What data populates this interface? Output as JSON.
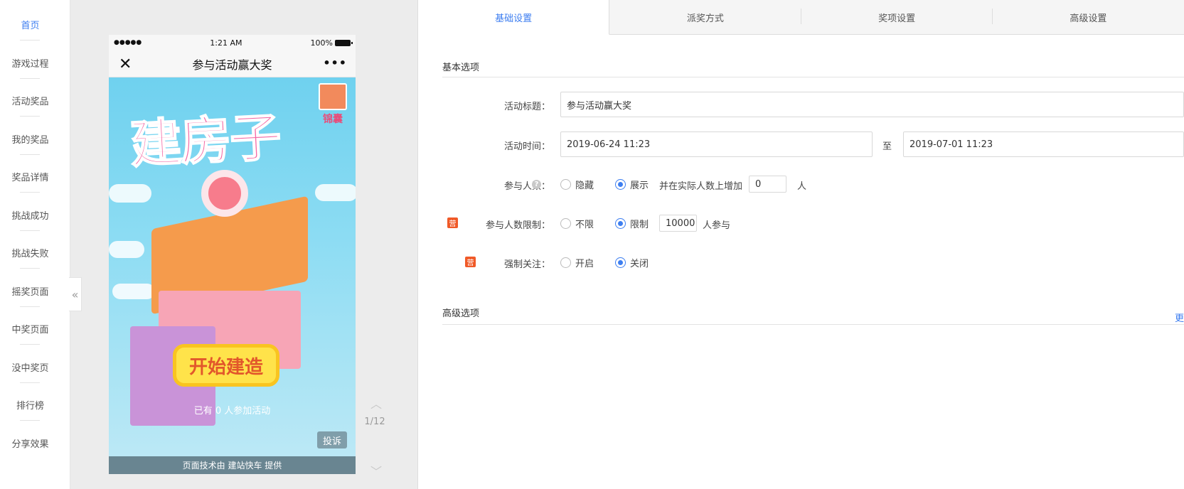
{
  "nav": {
    "items": [
      {
        "label": "首页",
        "active": true
      },
      {
        "label": "游戏过程"
      },
      {
        "label": "活动奖品"
      },
      {
        "label": "我的奖品"
      },
      {
        "label": "奖品详情"
      },
      {
        "label": "挑战成功"
      },
      {
        "label": "挑战失败"
      },
      {
        "label": "摇奖页面"
      },
      {
        "label": "中奖页面"
      },
      {
        "label": "没中奖页"
      },
      {
        "label": "排行榜"
      },
      {
        "label": "分享效果"
      }
    ],
    "collapse_glyph": "«"
  },
  "phone": {
    "status": {
      "signal": "●●●●●",
      "time": "1:21 AM",
      "battery": "100%"
    },
    "title": "参与活动赢大奖",
    "close_glyph": "✕",
    "more_glyph": "•••",
    "game": {
      "logo": "建房子",
      "logo_sub": "锦囊",
      "start_button": "开始建造",
      "join_text": "已有 0 人参加活动",
      "complain": "投诉",
      "footer": "页面技术由 建站快车 提供"
    }
  },
  "pager": {
    "text": "1/12",
    "up_glyph": "︿",
    "down_glyph": "﹀"
  },
  "tabs": [
    {
      "label": "基础设置",
      "active": true
    },
    {
      "label": "派奖方式"
    },
    {
      "label": "奖项设置"
    },
    {
      "label": "高级设置"
    }
  ],
  "basic": {
    "section_title": "基本选项",
    "title_label": "活动标题：",
    "title_value": "参与活动赢大奖",
    "time_label": "活动时间：",
    "time_start": "2019-06-24 11:23",
    "time_sep": "至",
    "time_end": "2019-07-01 11:23",
    "participants_label": "参与人数：",
    "help_glyph": "?",
    "opt_hide": "隐藏",
    "opt_show": "展示",
    "add_text": "并在实际人数上增加",
    "add_value": "0",
    "add_unit": "人",
    "badge_glyph": "营",
    "limit_label": "参与人数限制：",
    "opt_unlimited": "不限",
    "opt_limited": "限制",
    "limit_value": "10000",
    "limit_unit": "人参与",
    "follow_label": "强制关注：",
    "opt_on": "开启",
    "opt_off": "关闭"
  },
  "advanced": {
    "section_title": "高级选项",
    "more": "更"
  }
}
